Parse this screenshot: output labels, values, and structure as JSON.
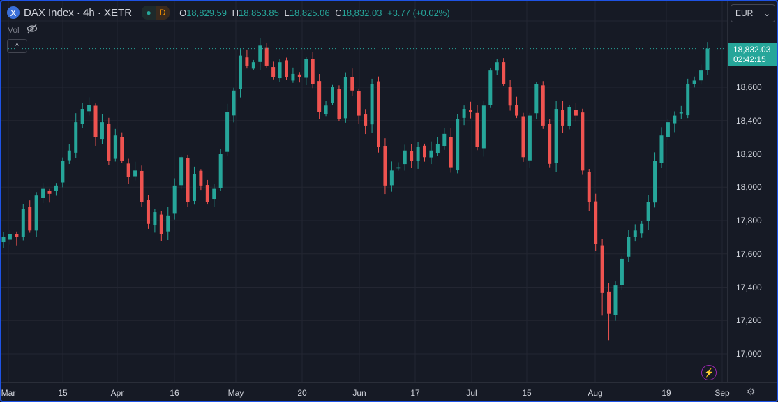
{
  "header": {
    "logo": "X",
    "symbol": "DAX Index · 4h · XETR",
    "status_dot": "●",
    "status_letter": "D",
    "o_label": "O",
    "o": "18,829.59",
    "h_label": "H",
    "h": "18,853.85",
    "l_label": "L",
    "l": "18,825.06",
    "c_label": "C",
    "c": "18,832.03",
    "change": "+3.77 (+0.02%)"
  },
  "volume": {
    "label": "Vol",
    "icon": "eye-off-icon"
  },
  "collapse_icon": "^",
  "currency": {
    "value": "EUR",
    "chevron": "⌄"
  },
  "last_price": {
    "price": "18,832.03",
    "countdown": "02:42:15"
  },
  "bolt_icon": "⚡",
  "settings_icon": "⚙",
  "colors": {
    "up": "#26a69a",
    "down": "#ef5350",
    "grid": "#232632",
    "bg": "#161a25"
  },
  "chart_data": {
    "type": "candlestick",
    "title": "DAX Index · 4h · XETR",
    "ylim": [
      16860,
      18985
    ],
    "yticks": [
      "18,600",
      "18,400",
      "18,200",
      "18,000",
      "17,800",
      "17,600",
      "17,400",
      "17,200",
      "17,000"
    ],
    "ytick_values": [
      18600,
      18400,
      18200,
      18000,
      17800,
      17600,
      17400,
      17200,
      17000
    ],
    "xticks": [
      "Mar",
      "15",
      "Apr",
      "16",
      "May",
      "20",
      "Jun",
      "17",
      "Jul",
      "15",
      "Aug",
      "19",
      "Sep"
    ],
    "closes": [
      17700,
      17720,
      17700,
      17870,
      17740,
      17950,
      17990,
      17960,
      18010,
      18160,
      18220,
      18390,
      18470,
      18495,
      18300,
      18390,
      18160,
      18310,
      18160,
      18060,
      18100,
      17910,
      17780,
      17850,
      17720,
      17830,
      18010,
      18180,
      17910,
      18080,
      18010,
      17910,
      17990,
      18200,
      18450,
      18580,
      18790,
      18730,
      18750,
      18850,
      18730,
      18660,
      18750,
      18660,
      18680,
      18660,
      18770,
      18620,
      18450,
      18490,
      18600,
      18410,
      18660,
      18580,
      18430,
      18370,
      18620,
      18240,
      18010,
      18100,
      18120,
      18220,
      18160,
      18240,
      18180,
      18220,
      18260,
      18320,
      18120,
      18410,
      18470,
      18450,
      18240,
      18490,
      18700,
      18750,
      18620,
      18490,
      18430,
      18180,
      18430,
      18620,
      18370,
      18140,
      18470,
      18370,
      18480,
      18430,
      18100,
      17910,
      17660,
      17365,
      17240,
      17410,
      17570,
      17700,
      17740,
      17780,
      17910,
      18160,
      18310,
      18390,
      18430,
      18450,
      18620,
      18640,
      18700,
      18832
    ],
    "last_close": 18832.03
  }
}
